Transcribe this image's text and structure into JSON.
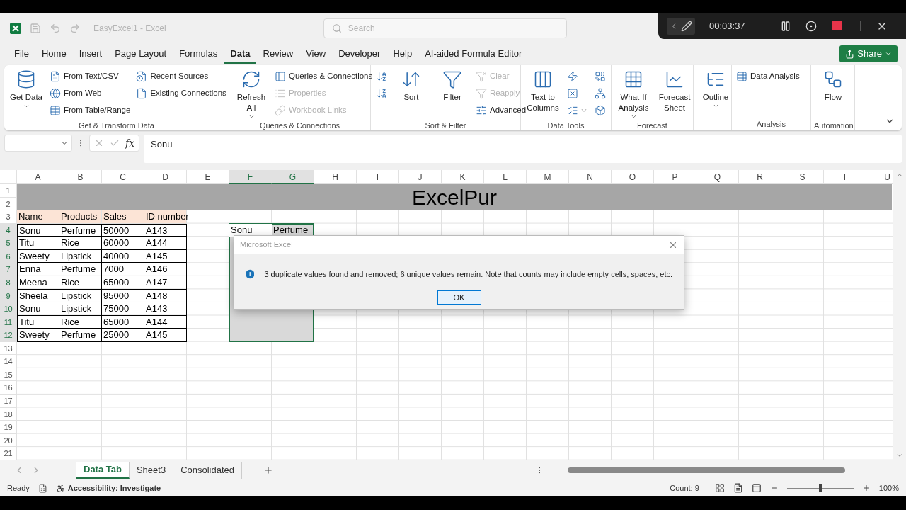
{
  "title_bar": {
    "title": "EasyExcel1 - Excel",
    "search": {
      "placeholder": "Search"
    }
  },
  "recorder": {
    "time": "00:03:37"
  },
  "menu_tabs": [
    {
      "label": "File",
      "selected": false
    },
    {
      "label": "Home",
      "selected": false
    },
    {
      "label": "Insert",
      "selected": false
    },
    {
      "label": "Page Layout",
      "selected": false
    },
    {
      "label": "Formulas",
      "selected": false
    },
    {
      "label": "Data",
      "selected": true
    },
    {
      "label": "Review",
      "selected": false
    },
    {
      "label": "View",
      "selected": false
    },
    {
      "label": "Developer",
      "selected": false
    },
    {
      "label": "Help",
      "selected": false
    },
    {
      "label": "AI-aided Formula Editor",
      "selected": false
    }
  ],
  "share_button": {
    "label": "Share"
  },
  "ribbon_groups": [
    {
      "label": "Get & Transform Data",
      "columns": [
        [
          {
            "kind": "large",
            "label": "Get Data",
            "dropdown": true,
            "disabled": false
          }
        ],
        [
          {
            "kind": "small",
            "label": "From Text/CSV",
            "disabled": false
          },
          {
            "kind": "small",
            "label": "From Web",
            "disabled": false
          },
          {
            "kind": "small",
            "label": "From Table/Range",
            "disabled": false
          }
        ],
        [
          {
            "kind": "small",
            "label": "Recent Sources",
            "disabled": false
          },
          {
            "kind": "small",
            "label": "Existing Connections",
            "disabled": false
          }
        ]
      ]
    },
    {
      "label": "Queries & Connections",
      "columns": [
        [
          {
            "kind": "large",
            "label": "Refresh All",
            "dropdown": true,
            "disabled": false
          }
        ],
        [
          {
            "kind": "small",
            "label": "Queries & Connections",
            "disabled": false
          },
          {
            "kind": "small",
            "label": "Properties",
            "disabled": true
          },
          {
            "kind": "small",
            "label": "Workbook Links",
            "disabled": true
          }
        ]
      ]
    },
    {
      "label": "Sort & Filter",
      "columns": [
        [
          {
            "kind": "icon",
            "disabled": false
          },
          {
            "kind": "icon",
            "disabled": false
          }
        ],
        [
          {
            "kind": "large",
            "label": "Sort",
            "disabled": false
          }
        ],
        [
          {
            "kind": "large",
            "label": "Filter",
            "disabled": false
          }
        ],
        [
          {
            "kind": "small",
            "label": "Clear",
            "disabled": true
          },
          {
            "kind": "small",
            "label": "Reapply",
            "disabled": true
          },
          {
            "kind": "small",
            "label": "Advanced",
            "disabled": false
          }
        ]
      ]
    },
    {
      "label": "Data Tools",
      "columns": [
        [
          {
            "kind": "large",
            "label": "Text to Columns",
            "disabled": false
          }
        ],
        [
          {
            "kind": "icon",
            "disabled": false
          },
          {
            "kind": "icon",
            "disabled": false
          },
          {
            "kind": "icon",
            "dropdown": true,
            "disabled": false
          }
        ],
        [
          {
            "kind": "icon",
            "disabled": false
          },
          {
            "kind": "icon",
            "disabled": false
          },
          {
            "kind": "icon",
            "disabled": false
          }
        ]
      ]
    },
    {
      "label": "Forecast",
      "columns": [
        [
          {
            "kind": "large",
            "label": "What-If Analysis",
            "dropdown": true,
            "disabled": false
          }
        ],
        [
          {
            "kind": "large",
            "label": "Forecast Sheet",
            "disabled": false
          }
        ]
      ]
    },
    {
      "columns": [
        [
          {
            "kind": "large",
            "label": "Outline",
            "dropdown": true,
            "disabled": false
          }
        ]
      ]
    },
    {
      "label": "Analysis",
      "columns": [
        [
          {
            "kind": "small",
            "label": "Data Analysis",
            "disabled": false
          }
        ]
      ]
    },
    {
      "label": "Automation",
      "columns": [
        [
          {
            "kind": "large",
            "label": "Flow",
            "disabled": false
          }
        ]
      ]
    }
  ],
  "formula_bar": {
    "function_label": "fx",
    "value": "Sonu"
  },
  "sheet": {
    "columns": [
      {
        "label": "A",
        "selected": false
      },
      {
        "label": "B",
        "selected": false
      },
      {
        "label": "C",
        "selected": false
      },
      {
        "label": "D",
        "selected": false
      },
      {
        "label": "E",
        "selected": false
      },
      {
        "label": "F",
        "selected": true
      },
      {
        "label": "G",
        "selected": true
      },
      {
        "label": "H",
        "selected": false
      },
      {
        "label": "I",
        "selected": false
      },
      {
        "label": "J",
        "selected": false
      },
      {
        "label": "K",
        "selected": false
      },
      {
        "label": "L",
        "selected": false
      },
      {
        "label": "M",
        "selected": false
      },
      {
        "label": "N",
        "selected": false
      },
      {
        "label": "O",
        "selected": false
      },
      {
        "label": "P",
        "selected": false
      },
      {
        "label": "Q",
        "selected": false
      },
      {
        "label": "R",
        "selected": false
      },
      {
        "label": "S",
        "selected": false
      },
      {
        "label": "T",
        "selected": false
      },
      {
        "label": "U",
        "selected": false
      }
    ],
    "rows": [
      {
        "label": "1",
        "selected": false
      },
      {
        "label": "2",
        "selected": false
      },
      {
        "label": "3",
        "selected": false
      },
      {
        "label": "4",
        "selected": true
      },
      {
        "label": "5",
        "selected": true
      },
      {
        "label": "6",
        "selected": true
      },
      {
        "label": "7",
        "selected": true
      },
      {
        "label": "8",
        "selected": true
      },
      {
        "label": "9",
        "selected": true
      },
      {
        "label": "10",
        "selected": true
      },
      {
        "label": "11",
        "selected": true
      },
      {
        "label": "12",
        "selected": true
      },
      {
        "label": "13",
        "selected": false
      },
      {
        "label": "14",
        "selected": false
      },
      {
        "label": "15",
        "selected": false
      },
      {
        "label": "16",
        "selected": false
      },
      {
        "label": "17",
        "selected": false
      },
      {
        "label": "18",
        "selected": false
      },
      {
        "label": "19",
        "selected": false
      },
      {
        "label": "20",
        "selected": false
      },
      {
        "label": "21",
        "selected": false
      }
    ],
    "title_band": "ExcelPur",
    "data_table": {
      "header": [
        "Name",
        "Products",
        "Sales",
        "ID number"
      ],
      "rows": [
        [
          "Sonu",
          "Perfume",
          "50000",
          "A143"
        ],
        [
          "Titu",
          "Rice",
          "60000",
          "A144"
        ],
        [
          "Sweety",
          "Lipstick",
          "40000",
          "A145"
        ],
        [
          "Enna",
          "Perfume",
          "7000",
          "A146"
        ],
        [
          "Meena",
          "Rice",
          "65000",
          "A147"
        ],
        [
          "Sheela",
          "Lipstick",
          "95000",
          "A148"
        ],
        [
          "Sonu",
          "Lipstick",
          "75000",
          "A143"
        ],
        [
          "Titu",
          "Rice",
          "65000",
          "A144"
        ],
        [
          "Sweety",
          "Perfume",
          "25000",
          "A145"
        ]
      ]
    },
    "selection_cells": [
      "Sonu",
      "Perfume"
    ]
  },
  "dialog": {
    "title": "Microsoft Excel",
    "message": "3 duplicate values found and removed; 6 unique values remain. Note that counts may include empty cells, spaces, etc.",
    "button": "OK"
  },
  "sheet_tabs": [
    {
      "label": "Data Tab",
      "selected": true
    },
    {
      "label": "Sheet3",
      "selected": false
    },
    {
      "label": "Consolidated",
      "selected": false
    }
  ],
  "status_bar": {
    "ready": "Ready",
    "accessibility": "Accessibility: Investigate",
    "count": "Count: 9",
    "zoom": {
      "level": 0.5,
      "reading": "100%"
    }
  }
}
